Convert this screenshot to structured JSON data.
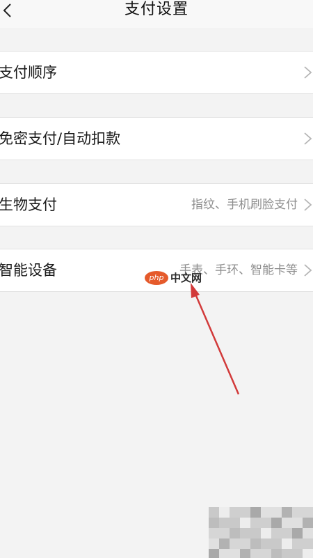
{
  "header": {
    "title": "支付设置",
    "back_icon": "chevron-left-icon"
  },
  "rows": [
    {
      "label": "支付顺序",
      "detail": ""
    },
    {
      "label": "免密支付/自动扣款",
      "detail": ""
    },
    {
      "label": "生物支付",
      "detail": "指纹、手机刷脸支付"
    },
    {
      "label": "智能设备",
      "detail": "手表、手环、智能卡等"
    }
  ],
  "watermark": {
    "logo": "php",
    "text": "中文网"
  },
  "colors": {
    "background": "#f3f3f3",
    "row_background": "#ffffff",
    "arrow": "#d23a3a",
    "detail_text": "#8e8e8e"
  }
}
